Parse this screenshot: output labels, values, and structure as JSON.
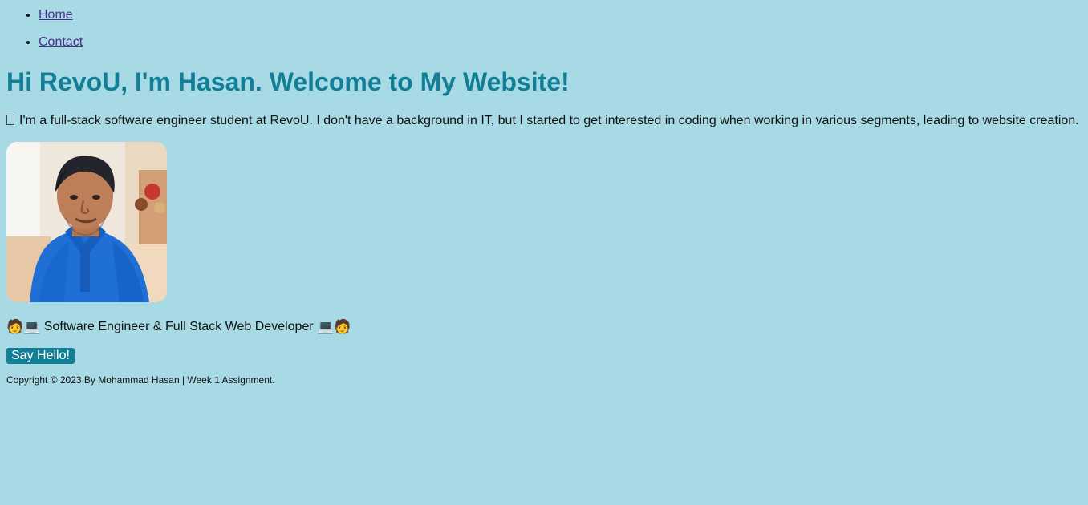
{
  "nav": {
    "items": [
      {
        "label": "Home"
      },
      {
        "label": "Contact"
      }
    ]
  },
  "hero": {
    "title": "Hi RevoU, I'm Hasan. Welcome to My Website!",
    "intro": "I'm a full-stack software engineer student at RevoU. I don't have a background in IT, but I started to get interested in coding when working in various segments, leading to website creation.",
    "tagline": "Software Engineer & Full Stack Web Developer",
    "left_emojis": "🧑💻",
    "right_emojis": "💻🧑"
  },
  "actions": {
    "say_hello_label": "Say Hello!"
  },
  "footer": {
    "text": "Copyright © 2023 By Mohammad Hasan | Week 1 Assignment."
  },
  "colors": {
    "background": "#a7dae4",
    "accent": "#137f97",
    "link": "#4f2c8f"
  },
  "icons": {
    "profile_photo": "profile-photo",
    "missing_glyph": "missing-glyph-icon",
    "person_laptop": "person-laptop-icon"
  }
}
